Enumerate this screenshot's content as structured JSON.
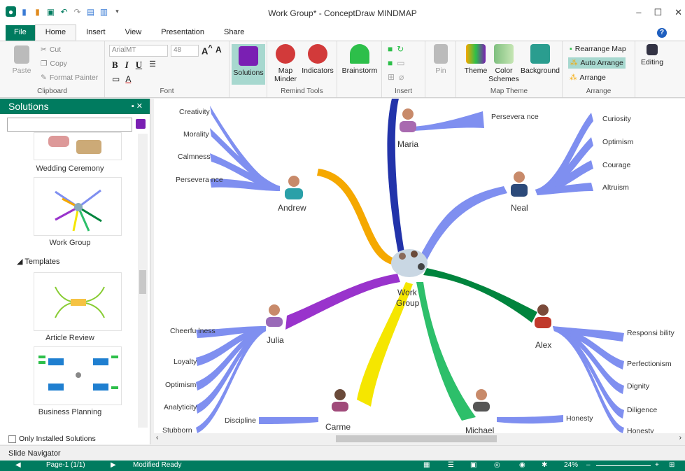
{
  "window": {
    "title": "Work Group* - ConceptDraw MINDMAP",
    "minimize": "–",
    "maximize": "☐",
    "close": "✕"
  },
  "tabs": [
    "File",
    "Home",
    "Insert",
    "View",
    "Presentation",
    "Share"
  ],
  "ribbon": {
    "clipboard": {
      "paste": "Paste",
      "cut": "Cut",
      "copy": "Copy",
      "format_painter": "Format Painter",
      "label": "Clipboard"
    },
    "font": {
      "family": "ArialMT",
      "size": "48",
      "label": "Font"
    },
    "solutions": "Solutions",
    "remind": {
      "map_minder": "Map Minder",
      "indicators": "Indicators",
      "label": "Remind Tools"
    },
    "brainstorm": "Brainstorm",
    "insert": {
      "pin": "Pin",
      "label": "Insert"
    },
    "map_theme": {
      "theme": "Theme",
      "color_schemes": "Color Schemes",
      "background": "Background",
      "label": "Map Theme"
    },
    "arrange": {
      "rearrange_map": "Rearrange Map",
      "auto_arrange": "Auto Arrange",
      "arrange": "Arrange",
      "label": "Arrange"
    },
    "editing": "Editing"
  },
  "solutions_panel": {
    "title": "Solutions",
    "items": [
      "Wedding Ceremony",
      "Work Group"
    ],
    "templates_header": "Templates",
    "templates": [
      "Article Review",
      "Business Planning"
    ],
    "only_installed": "Only Installed Solutions"
  },
  "mindmap": {
    "center": "Work Group",
    "nodes": [
      {
        "name": "Andrew",
        "leaves": [
          "Creativity",
          "Morality",
          "Calmness",
          "Persevera nce"
        ]
      },
      {
        "name": "Maria",
        "leaves": [
          "Persevera nce"
        ]
      },
      {
        "name": "Neal",
        "leaves": [
          "Curiosity",
          "Optimism",
          "Courage",
          "Altruism"
        ]
      },
      {
        "name": "Julia",
        "leaves": [
          "Cheerfu lness",
          "Loyalty",
          "Optimism",
          "Analyticity",
          "Stubborn"
        ]
      },
      {
        "name": "Alex",
        "leaves": [
          "Responsi bility",
          "Perfectionism",
          "Dignity",
          "Diligence",
          "Honesty"
        ]
      },
      {
        "name": "Carme",
        "leaves": [
          "Discipline"
        ]
      },
      {
        "name": "Michael",
        "leaves": [
          "Honesty"
        ]
      }
    ]
  },
  "slide_navigator": "Slide Navigator",
  "status": {
    "page": "Page-1 (1/1)",
    "state": "Modified  Ready",
    "zoom": "24%"
  },
  "colors": {
    "accent": "#007b5f",
    "orange": "#f5a800",
    "navy": "#2233aa",
    "periwinkle": "#7f8ff0",
    "purple": "#9933cc",
    "yellow": "#f5e600",
    "green": "#2dbf6a",
    "darkgreen": "#00843d"
  }
}
